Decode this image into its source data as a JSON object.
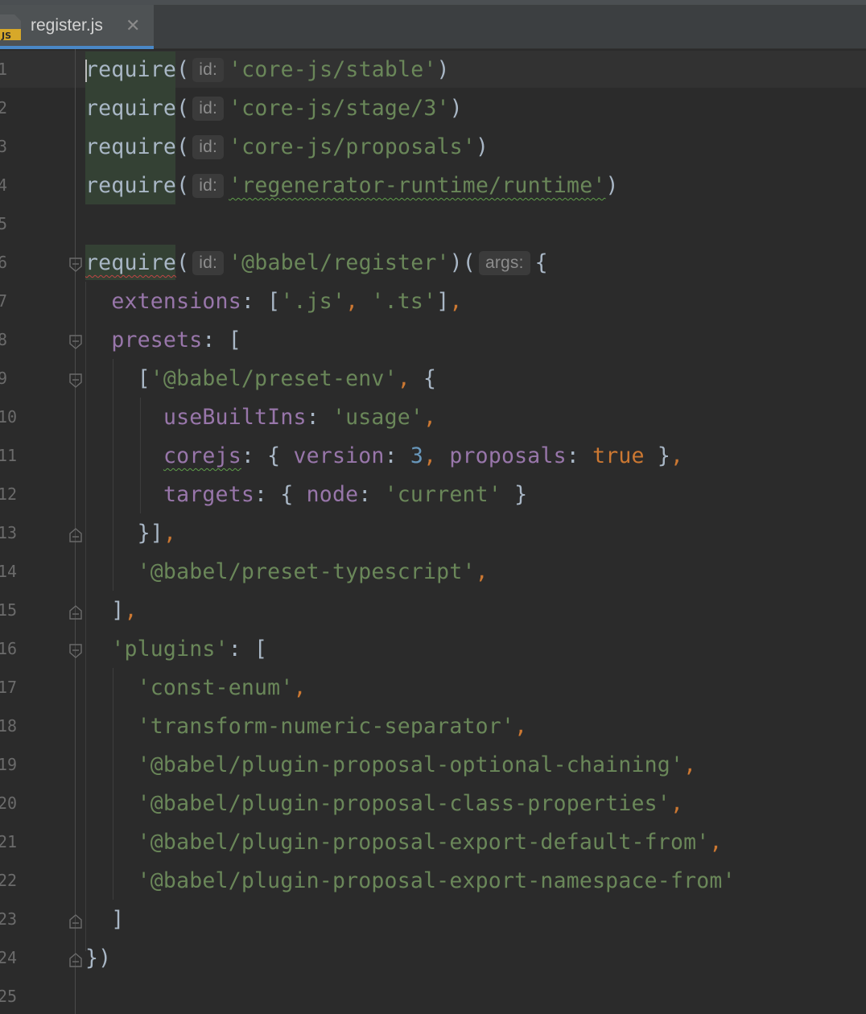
{
  "tab": {
    "title": "register.js",
    "icon_label": "JS",
    "close": "✕",
    "icon_color": "#d7a829"
  },
  "lines": [
    {
      "n": "1"
    },
    {
      "n": "2"
    },
    {
      "n": "3"
    },
    {
      "n": "4"
    },
    {
      "n": "5"
    },
    {
      "n": "6"
    },
    {
      "n": "7"
    },
    {
      "n": "8"
    },
    {
      "n": "9"
    },
    {
      "n": "10"
    },
    {
      "n": "11"
    },
    {
      "n": "12"
    },
    {
      "n": "13"
    },
    {
      "n": "14"
    },
    {
      "n": "15"
    },
    {
      "n": "16"
    },
    {
      "n": "17"
    },
    {
      "n": "18"
    },
    {
      "n": "19"
    },
    {
      "n": "20"
    },
    {
      "n": "21"
    },
    {
      "n": "22"
    },
    {
      "n": "23"
    },
    {
      "n": "24"
    },
    {
      "n": "25"
    }
  ],
  "code": {
    "require": "require",
    "hint_id": "id:",
    "hint_args": "args:",
    "l1_str": "'core-js/stable'",
    "l2_str": "'core-js/stage/3'",
    "l3_str": "'core-js/proposals'",
    "l4_str": "'regenerator-runtime/runtime'",
    "l6_str": "'@babel/register'",
    "extensions": "extensions",
    "ext_js": "'.js'",
    "ext_ts": "'.ts'",
    "presets": "presets",
    "preset_env": "'@babel/preset-env'",
    "useBuiltIns": "useBuiltIns",
    "usage": "'usage'",
    "corejs": "corejs",
    "version": "version",
    "version_num": "3",
    "proposals": "proposals",
    "true_kw": "true",
    "targets": "targets",
    "node": "node",
    "current": "'current'",
    "preset_ts": "'@babel/preset-typescript'",
    "plugins": "'plugins'",
    "p1": "'const-enum'",
    "p2": "'transform-numeric-separator'",
    "p3": "'@babel/plugin-proposal-optional-chaining'",
    "p4": "'@babel/plugin-proposal-class-properties'",
    "p5": "'@babel/plugin-proposal-export-default-from'",
    "p6": "'@babel/plugin-proposal-export-namespace-from'"
  }
}
